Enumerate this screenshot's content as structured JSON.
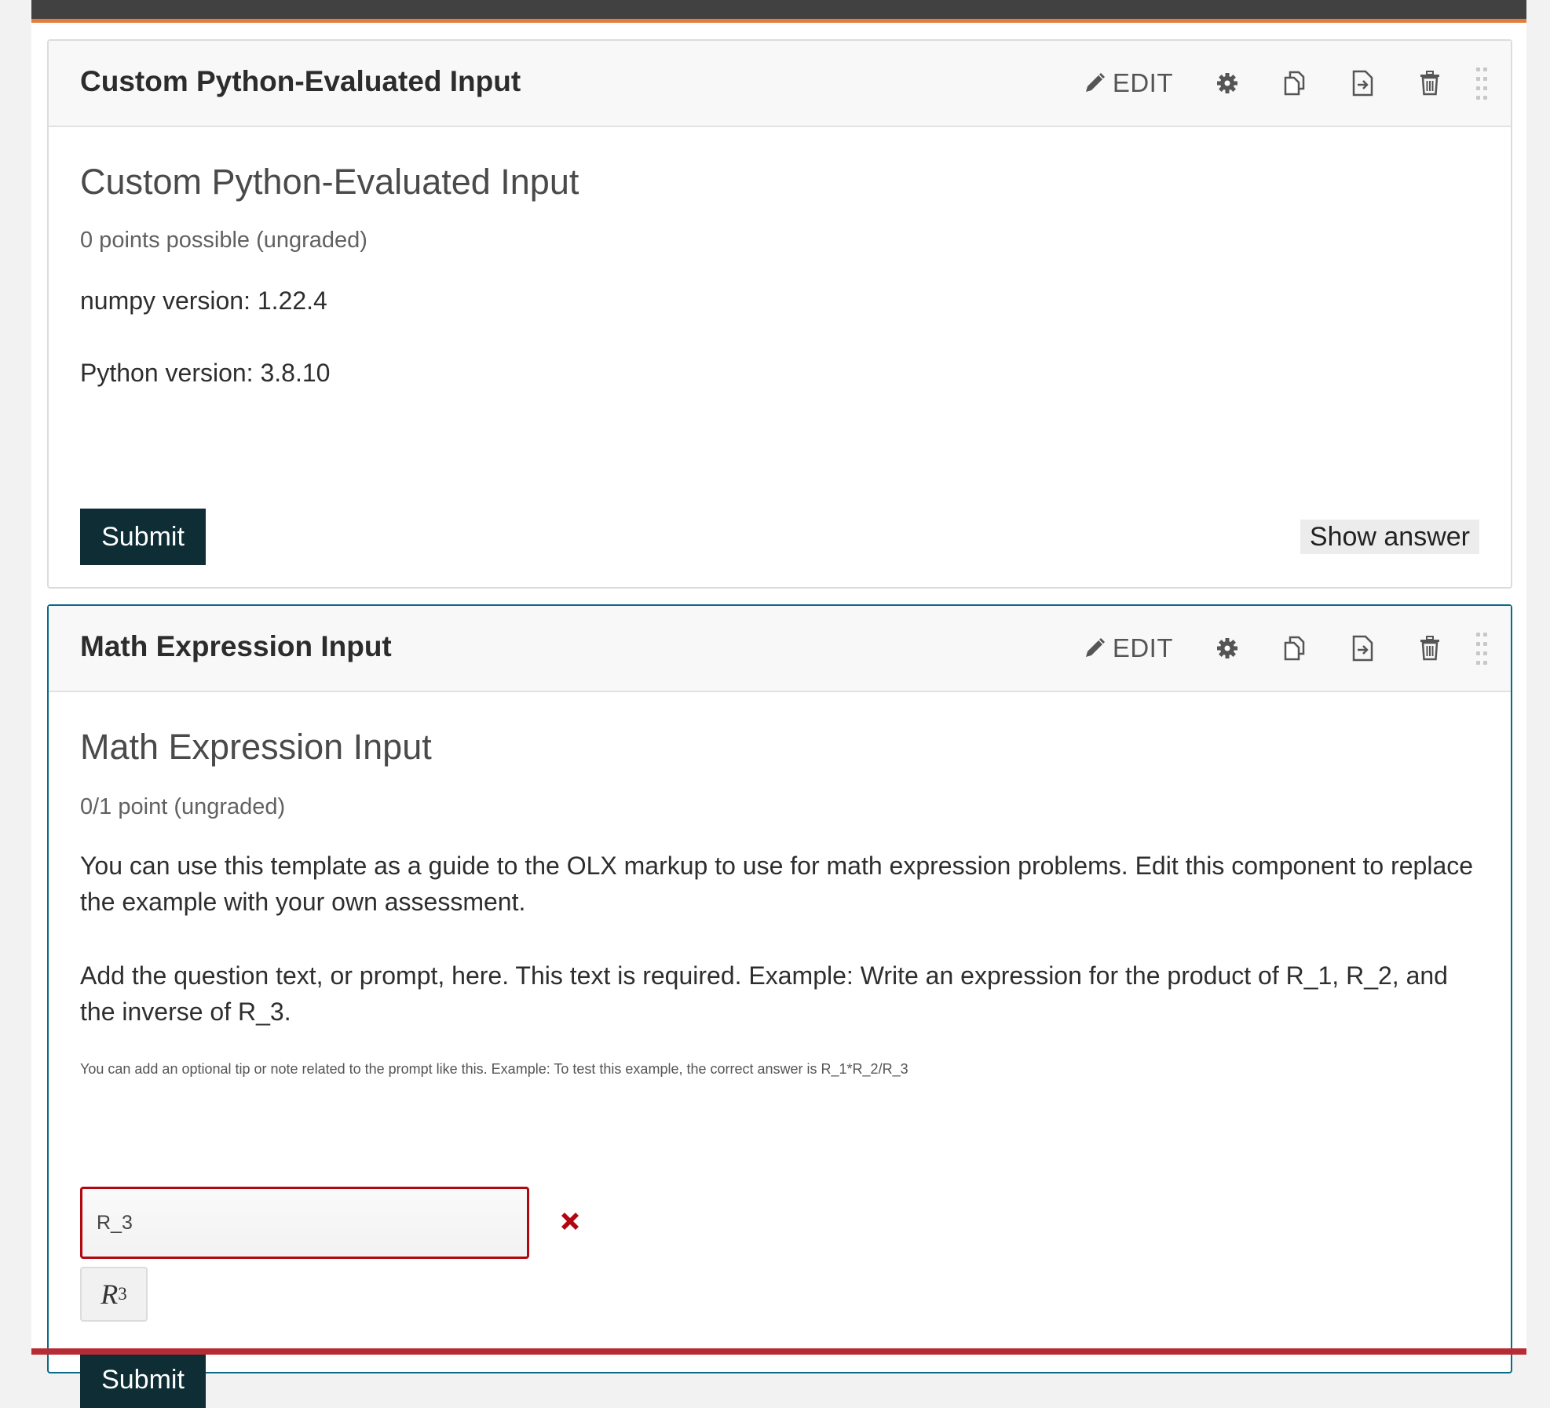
{
  "colors": {
    "topbar": "#414141",
    "accent_orange": "#e37c3b",
    "selected_border": "#0a6a8a",
    "submit_bg": "#0e2d35",
    "incorrect": "#b20610"
  },
  "components": [
    {
      "header_title": "Custom Python-Evaluated Input",
      "edit_label": "EDIT",
      "icons": [
        "pencil-icon",
        "gear-icon",
        "duplicate-icon",
        "move-icon",
        "trash-icon",
        "drag-handle-icon"
      ],
      "problem_title": "Custom Python-Evaluated Input",
      "points": "0 points possible (ungraded)",
      "lines": [
        "numpy version: 1.22.4",
        "Python version: 3.8.10"
      ],
      "submit_label": "Submit",
      "show_answer_label": "Show answer"
    },
    {
      "header_title": "Math Expression Input",
      "edit_label": "EDIT",
      "problem_title": "Math Expression Input",
      "points": "0/1 point (ungraded)",
      "intro": "You can use this template as a guide to the OLX markup to use for math expression problems. Edit this component to replace the example with your own assessment.",
      "prompt": "Add the question text, or prompt, here. This text is required. Example: Write an expression for the product of R_1, R_2, and the inverse of R_3.",
      "tip": "You can add an optional tip or note related to the prompt like this. Example: To test this example, the correct answer is R_1*R_2/R_3",
      "input_value": "R_3",
      "status": "incorrect",
      "preview_base": "R",
      "preview_sub": "3",
      "submit_label": "Submit"
    }
  ]
}
